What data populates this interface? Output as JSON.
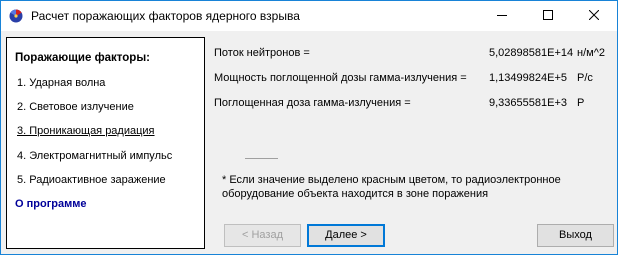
{
  "window": {
    "title": "Расчет поражающих факторов ядерного взрыва",
    "icons": {
      "app": "nuclear-app-icon",
      "minimize": "minimize-icon",
      "maximize": "maximize-icon",
      "close": "close-icon"
    }
  },
  "sidebar": {
    "heading": "Поражающие факторы:",
    "items": [
      {
        "label": "1. Ударная волна",
        "active": false
      },
      {
        "label": "2. Световое излучение",
        "active": false
      },
      {
        "label": "3. Проникающая радиация",
        "active": true
      },
      {
        "label": "4. Электромагнитный импульс",
        "active": false
      },
      {
        "label": "5. Радиоактивное заражение",
        "active": false
      }
    ],
    "about": "О программе"
  },
  "results": [
    {
      "label": "Поток нейтронов =",
      "value": "5,02898581E+14",
      "unit": "н/м^2"
    },
    {
      "label": "Мощность поглощенной дозы гамма-излучения =",
      "value": "1,13499824E+5",
      "unit": "Р/с"
    },
    {
      "label": "Поглощенная доза гамма-излучения =",
      "value": "9,33655581E+3",
      "unit": "Р"
    }
  ],
  "note": "* Если значение выделено красным цветом, то радиоэлектронное оборудование объекта находится в зоне поражения",
  "buttons": {
    "back": "< Назад",
    "next": "Далее >",
    "exit": "Выход"
  },
  "colors": {
    "about_link": "#000099",
    "window_border": "#1883d7",
    "focus_border": "#0078d7"
  }
}
